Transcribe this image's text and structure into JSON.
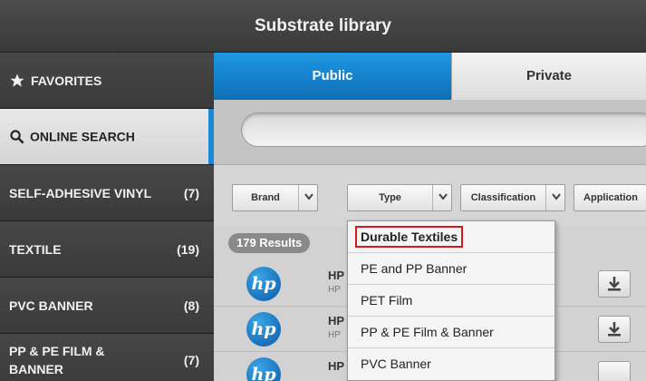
{
  "window": {
    "title": "Substrate library"
  },
  "sidebar": {
    "items": [
      {
        "label": "FAVORITES",
        "count": "",
        "icon": "star-icon"
      },
      {
        "label": "ONLINE SEARCH",
        "count": "",
        "icon": "search-icon",
        "active": true
      },
      {
        "label": "SELF-ADHESIVE VINYL",
        "count": "(7)"
      },
      {
        "label": "TEXTILE",
        "count": "(19)"
      },
      {
        "label": "PVC BANNER",
        "count": "(8)"
      },
      {
        "label": "PP & PE FILM &",
        "label2": "BANNER",
        "count": "(7)"
      }
    ]
  },
  "tabs": [
    {
      "label": "Public",
      "active": true
    },
    {
      "label": "Private"
    }
  ],
  "search": {
    "value": ""
  },
  "filters": [
    {
      "label": "Brand"
    },
    {
      "label": "Type"
    },
    {
      "label": "Classification"
    },
    {
      "label": "Application"
    }
  ],
  "results": {
    "count_label": "179 Results",
    "rows": [
      {
        "name": "HP",
        "brand": "HP"
      },
      {
        "name": "HP",
        "brand": "HP"
      },
      {
        "name": "HP",
        "brand": ""
      }
    ]
  },
  "type_dropdown": {
    "options": [
      "Durable Textiles",
      "PE and PP Banner",
      "PET Film",
      "PP & PE Film & Banner",
      "PVC Banner"
    ],
    "highlighted": "Durable Textiles"
  },
  "colors": {
    "accent": "#1b8ad6",
    "highlight": "#d01c1c"
  }
}
